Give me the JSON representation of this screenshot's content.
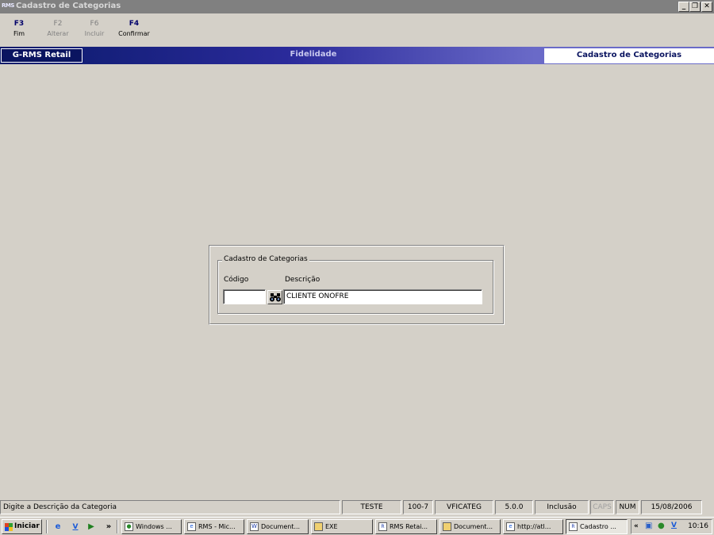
{
  "window": {
    "title": "Cadastro de Categorias",
    "icon_text": "RMS"
  },
  "toolbar": {
    "buttons": [
      {
        "key": "F3",
        "label": "Fim",
        "enabled": true
      },
      {
        "key": "F2",
        "label": "Alterar",
        "enabled": false
      },
      {
        "key": "F6",
        "label": "Incluir",
        "enabled": false
      },
      {
        "key": "F4",
        "label": "Confirmar",
        "enabled": true
      }
    ]
  },
  "banner": {
    "brand": "G-RMS Retail",
    "module": "Fidelidade",
    "screen": "Cadastro de Categorias"
  },
  "form": {
    "group_title": "Cadastro de Categorias",
    "codigo_label": "Código",
    "codigo_value": "",
    "descricao_label": "Descrição",
    "descricao_value": "CLIENTE ONOFRE"
  },
  "statusbar": {
    "message": "Digite a Descrição da Categoria",
    "database": "TESTE",
    "code": "100-7",
    "program": "VFICATEG",
    "version": "5.0.0",
    "mode": "Inclusão",
    "caps": "CAPS",
    "num": "NUM",
    "date": "15/08/2006"
  },
  "taskbar": {
    "start_label": "Iniciar",
    "chevron": "»",
    "tasks": [
      {
        "label": "Windows ...",
        "icon": "users-icon"
      },
      {
        "label": "RMS - Mic...",
        "icon": "ie-icon"
      },
      {
        "label": "Document...",
        "icon": "word-icon"
      },
      {
        "label": "EXE",
        "icon": "folder-icon"
      },
      {
        "label": "RMS Retai...",
        "icon": "rms-icon"
      },
      {
        "label": "Document...",
        "icon": "folder-icon"
      },
      {
        "label": "http://atl...",
        "icon": "ie-icon"
      },
      {
        "label": "Cadastro ...",
        "icon": "rms-icon"
      }
    ],
    "tray_chevron": "«",
    "clock": "10:16"
  }
}
